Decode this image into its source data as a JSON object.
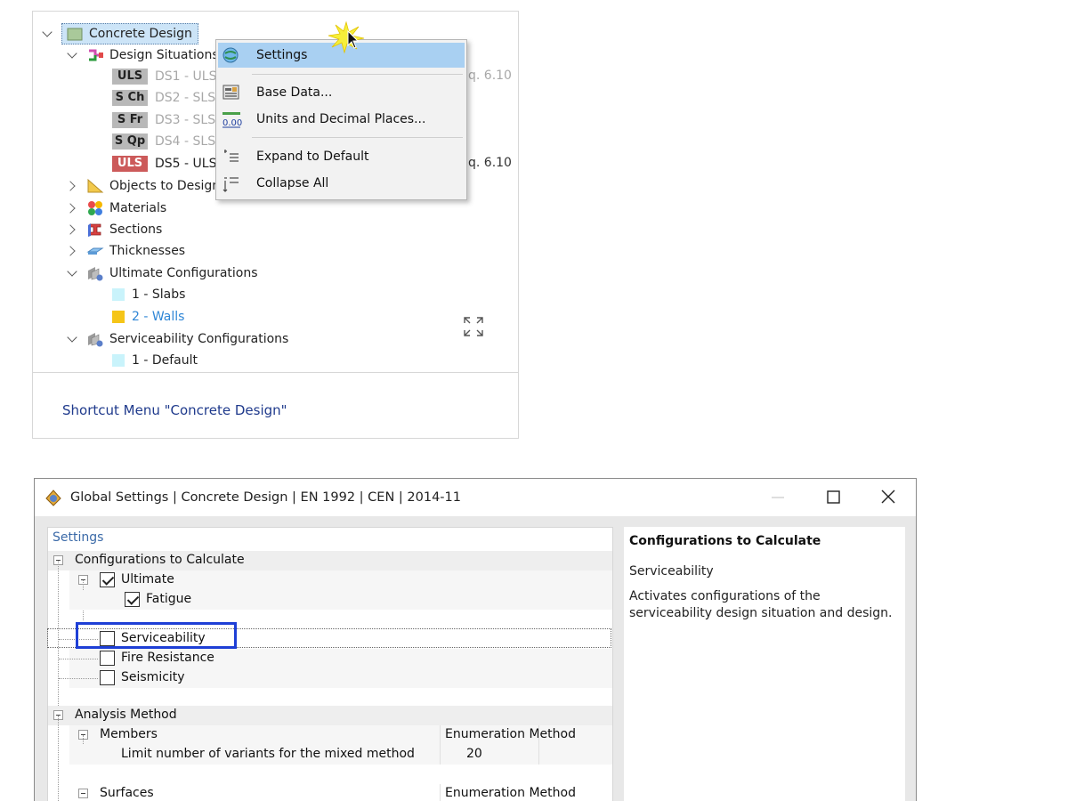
{
  "tree": {
    "root": "Concrete Design",
    "design_situations": "Design Situations",
    "items": [
      {
        "badge": "ULS",
        "name": "DS1 - ULS",
        "eq": "q. 6.10",
        "active": false
      },
      {
        "badge": "S Ch",
        "name": "DS2 - SLS",
        "eq": "",
        "active": false
      },
      {
        "badge": "S Fr",
        "name": "DS3 - SLS",
        "eq": "",
        "active": false
      },
      {
        "badge": "S Qp",
        "name": "DS4 - SLS",
        "eq": "",
        "active": false
      },
      {
        "badge": "ULS",
        "name": "DS5 - ULS",
        "eq": "q. 6.10",
        "active": true
      }
    ],
    "objects_to_design": "Objects to Design",
    "materials": "Materials",
    "sections": "Sections",
    "thicknesses": "Thicknesses",
    "ultimate_configurations": "Ultimate Configurations",
    "uc_items": [
      {
        "label": "1 - Slabs",
        "color": "#c9f3fb"
      },
      {
        "label": "2 - Walls",
        "color": "#f5c518"
      }
    ],
    "serviceability_configurations": "Serviceability Configurations",
    "sc_items": [
      {
        "label": "1 - Default",
        "color": "#c9f3fb"
      }
    ],
    "caption": "Shortcut Menu \"Concrete Design\""
  },
  "context_menu": {
    "settings": "Settings",
    "base_data": "Base Data...",
    "units": "Units and Decimal Places...",
    "units_icon_text": "0.00",
    "expand": "Expand to Default",
    "collapse": "Collapse All"
  },
  "dialog": {
    "title": "Global Settings | Concrete Design | EN 1992 | CEN | 2014-11",
    "settings_header": "Settings",
    "configurations_to_calculate": "Configurations to Calculate",
    "ultimate": "Ultimate",
    "fatigue": "Fatigue",
    "serviceability": "Serviceability",
    "fire_resistance": "Fire Resistance",
    "seismicity": "Seismicity",
    "analysis_method": "Analysis Method",
    "members": "Members",
    "members_value": "Enumeration Method",
    "limit_variants": "Limit number of variants for the mixed method",
    "limit_value": "20",
    "surfaces": "Surfaces",
    "surfaces_value": "Enumeration Method",
    "checks": {
      "ultimate": true,
      "fatigue": true,
      "serviceability": false,
      "fire_resistance": false,
      "seismicity": false
    }
  },
  "info": {
    "title": "Configurations to Calculate",
    "subtitle": "Serviceability",
    "description": "Activates configurations of the serviceability design situation and design."
  }
}
